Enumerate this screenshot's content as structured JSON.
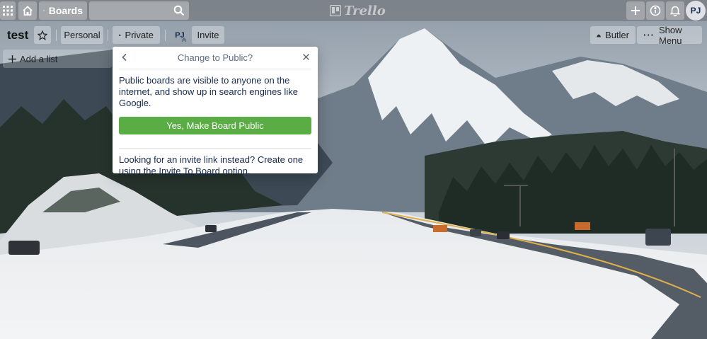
{
  "topbar": {
    "apps_icon": "grid-icon",
    "home_icon": "home-icon",
    "boards_label": "Boards",
    "search_placeholder": "",
    "logo_text": "Trello",
    "actions": [
      "plus-icon",
      "info-icon",
      "bell-icon"
    ],
    "avatar_initials": "PJ"
  },
  "board": {
    "title": "test",
    "team_label": "Personal",
    "visibility_label": "Private",
    "member_initials": "PJ",
    "invite_label": "Invite",
    "butler_label": "Butler",
    "show_menu_label": "Show Menu",
    "add_list_label": "Add a list"
  },
  "popover": {
    "title": "Change to Public?",
    "description": "Public boards are visible to anyone on the internet, and show up in search engines like Google.",
    "button_label": "Yes, Make Board Public",
    "footer_prefix": "Looking for an invite link instead? Create one using the",
    "footer_link": "Invite To Board",
    "footer_suffix": "option."
  },
  "colors": {
    "primary_button": "#5aac44",
    "topbar": "#787c82",
    "popover_text": "#172b4d"
  }
}
